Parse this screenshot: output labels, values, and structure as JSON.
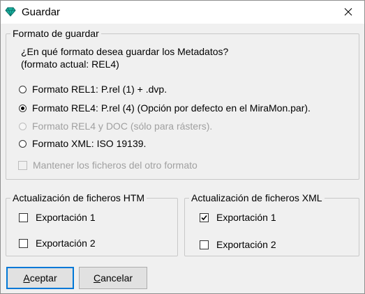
{
  "window": {
    "title": "Guardar",
    "app_icon": "diamond-icon",
    "close_icon": "close-icon"
  },
  "format_group": {
    "legend": "Formato de guardar",
    "question_line1": "¿En qué formato desea guardar los Metadatos?",
    "question_line2": "(formato actual: REL4)",
    "options": [
      {
        "label": "Formato REL1: P.rel (1) + .dvp.",
        "checked": false,
        "enabled": true
      },
      {
        "label": "Formato REL4: P.rel (4) (Opción por defecto en el MiraMon.par).",
        "checked": true,
        "enabled": true
      },
      {
        "label": "Formato REL4 y DOC (sólo para rásters).",
        "checked": false,
        "enabled": false
      },
      {
        "label": "Formato XML: ISO 19139.",
        "checked": false,
        "enabled": true
      }
    ],
    "keep_files": {
      "label": "Mantener los ficheros del otro formato",
      "checked": false,
      "enabled": false
    }
  },
  "htm_group": {
    "legend": "Actualización de ficheros HTM",
    "items": [
      {
        "label": "Exportación 1",
        "checked": false
      },
      {
        "label": "Exportación 2",
        "checked": false
      }
    ]
  },
  "xml_group": {
    "legend": "Actualización de ficheros XML",
    "items": [
      {
        "label": "Exportación 1",
        "checked": true
      },
      {
        "label": "Exportación 2",
        "checked": false
      }
    ]
  },
  "buttons": {
    "accept": {
      "mnemonic": "A",
      "rest": "ceptar"
    },
    "cancel": {
      "mnemonic": "C",
      "rest": "ancelar"
    }
  },
  "colors": {
    "accent": "#0078d7",
    "dialog_bg": "#f0f0f0",
    "disabled_text": "#a0a0a0"
  }
}
